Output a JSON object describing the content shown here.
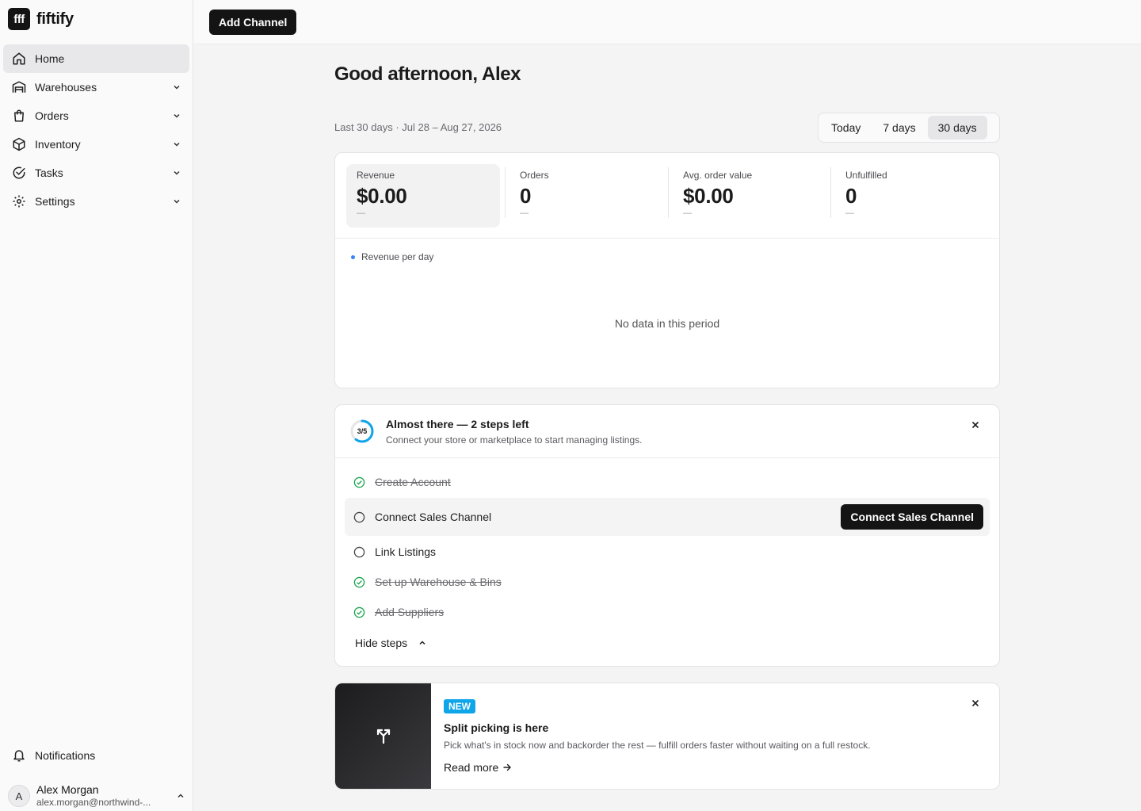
{
  "brand": {
    "logo_text": "fff",
    "name": "fiftify"
  },
  "topbar": {
    "add_channel_label": "Add Channel"
  },
  "sidebar": {
    "items": [
      {
        "label": "Home",
        "icon": "home-icon",
        "active": true
      },
      {
        "label": "Warehouses",
        "icon": "warehouse-icon"
      },
      {
        "label": "Orders",
        "icon": "shopping-bag-icon"
      },
      {
        "label": "Inventory",
        "icon": "box-icon"
      },
      {
        "label": "Tasks",
        "icon": "check-circle-icon"
      },
      {
        "label": "Settings",
        "icon": "gear-icon"
      }
    ],
    "notifications_label": "Notifications",
    "user": {
      "initial": "A",
      "name": "Alex Morgan",
      "email": "alex.morgan@northwind-..."
    }
  },
  "main": {
    "greeting": "Good afternoon, Alex",
    "period_label": "Last 30 days · Jul 28 – Aug 27, 2026",
    "ranges": [
      {
        "label": "Today"
      },
      {
        "label": "7 days"
      },
      {
        "label": "30 days",
        "active": true
      }
    ],
    "stats": [
      {
        "label": "Revenue",
        "value": "$0.00",
        "delta": "—"
      },
      {
        "label": "Orders",
        "value": "0",
        "delta": "—"
      },
      {
        "label": "Avg. order value",
        "value": "$0.00",
        "delta": "—"
      },
      {
        "label": "Unfulfilled",
        "value": "0",
        "delta": "—"
      }
    ],
    "chart": {
      "legend": "Revenue per day",
      "empty_message": "No data in this period",
      "legend_color": "#3b82f6"
    }
  },
  "onboarding": {
    "progress_text": "3/5",
    "progress_done": 3,
    "progress_total": 5,
    "title": "Almost there — 2 steps left",
    "subtitle": "Connect your store or marketplace to start managing listings.",
    "steps": [
      {
        "label": "Create Account",
        "done": true
      },
      {
        "label": "Connect Sales Channel",
        "done": false,
        "action_label": "Connect Sales Channel"
      },
      {
        "label": "Link Listings",
        "done": false
      },
      {
        "label": "Set up Warehouse & Bins",
        "done": true
      },
      {
        "label": "Add Suppliers",
        "done": true
      }
    ],
    "hide_steps_label": "Hide steps",
    "accent_color": "#0ea5e9",
    "done_color": "#16a34a"
  },
  "promo": {
    "badge": "NEW",
    "title": "Split picking is here",
    "description": "Pick what's in stock now and backorder the rest — fulfill orders faster without waiting on a full restock.",
    "link_label": "Read more",
    "icon": "split-arrow-icon"
  }
}
